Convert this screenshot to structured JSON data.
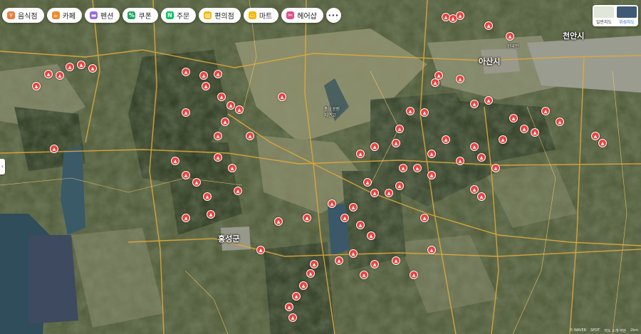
{
  "categories": [
    {
      "label": "음식점",
      "icon": "fork-knife-icon",
      "color": "#f07a3b"
    },
    {
      "label": "카페",
      "icon": "coffee-icon",
      "color": "#f08a2b"
    },
    {
      "label": "펜션",
      "icon": "bed-icon",
      "color": "#9a6be0"
    },
    {
      "label": "쿠폰",
      "icon": "coupon-icon",
      "color": "#1aa35a"
    },
    {
      "label": "주문",
      "icon": "naver-n-icon",
      "color": "#03c75a"
    },
    {
      "label": "편의점",
      "icon": "store-icon",
      "color": "#f5b800"
    },
    {
      "label": "마트",
      "icon": "cart-icon",
      "color": "#f5b800"
    },
    {
      "label": "헤어샵",
      "icon": "scissors-icon",
      "color": "#e0508a"
    }
  ],
  "more_label": "···",
  "map_type": {
    "normal": "일반지도",
    "satellite": "위성지도",
    "active": "satellite"
  },
  "side_toggle": "‹",
  "region_labels": {
    "hongseong": "홍성군",
    "asan": "아산시",
    "cheonan": "천안시"
  },
  "point_labels": {
    "hangyeong": "한국민",
    "chungcheong": "충남공원\n자연고"
  },
  "copyright": {
    "naver": "© NAVER",
    "spot": "SPOT",
    "nav": "지도 소개·약관",
    "scale": "2km"
  }
}
